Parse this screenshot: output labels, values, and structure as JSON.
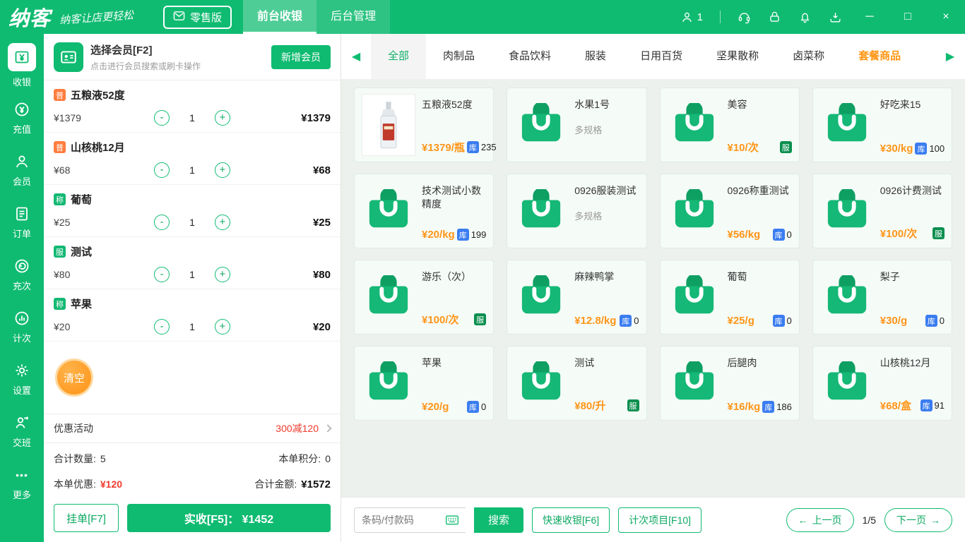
{
  "icons": {
    "minus": "-",
    "plus": "+",
    "prev": "◀",
    "next": "▶",
    "minimize": "─",
    "maximize": "□",
    "close": "×",
    "more": "•••",
    "arrow_left": "←",
    "arrow_right": "→"
  },
  "topbar": {
    "logo": "纳客",
    "slogan": "纳客让店更轻松",
    "edition": "零售版",
    "tabs": [
      {
        "label": "前台收银"
      },
      {
        "label": "后台管理"
      }
    ],
    "user_count": "1"
  },
  "sidebar": {
    "items": [
      {
        "label": "收银"
      },
      {
        "label": "充值"
      },
      {
        "label": "会员"
      },
      {
        "label": "订单"
      },
      {
        "label": "充次"
      },
      {
        "label": "计次"
      },
      {
        "label": "设置"
      },
      {
        "label": "交班"
      },
      {
        "label": "更多"
      }
    ]
  },
  "cart": {
    "member": {
      "title": "选择会员[F2]",
      "subtitle": "点击进行会员搜索或刷卡操作",
      "add_button": "新增会员"
    },
    "items": [
      {
        "tag": "普",
        "name": "五粮液52度",
        "price": "¥1379",
        "qty": "1",
        "total": "¥1379"
      },
      {
        "tag": "普",
        "name": "山核桃12月",
        "price": "¥68",
        "qty": "1",
        "total": "¥68"
      },
      {
        "tag": "称",
        "name": "葡萄",
        "price": "¥25",
        "qty": "1",
        "total": "¥25"
      },
      {
        "tag": "服",
        "name": "测试",
        "price": "¥80",
        "qty": "1",
        "total": "¥80"
      },
      {
        "tag": "称",
        "name": "苹果",
        "price": "¥20",
        "qty": "1",
        "total": "¥20"
      }
    ],
    "clear_button": "清空",
    "promo": {
      "label": "优惠活动",
      "value": "300减120"
    },
    "summary": {
      "qty_label": "合计数量:",
      "qty_value": "5",
      "points_label": "本单积分:",
      "points_value": "0",
      "discount_label": "本单优惠:",
      "discount_value": "¥120",
      "total_label": "合计金额:",
      "total_value": "¥1572"
    },
    "hold_button": "挂单[F7]",
    "pay_button": "实收[F5]： ¥1452"
  },
  "catalog": {
    "categories": [
      {
        "label": "全部"
      },
      {
        "label": "肉制品"
      },
      {
        "label": "食品饮料"
      },
      {
        "label": "服装"
      },
      {
        "label": "日用百货"
      },
      {
        "label": "坚果散称"
      },
      {
        "label": "卤菜称"
      },
      {
        "label": "套餐商品"
      }
    ],
    "products": [
      {
        "name": "五粮液52度",
        "price": "¥1379/瓶",
        "badge": "库",
        "stock": "235"
      },
      {
        "name": "水果1号",
        "spec": "多规格"
      },
      {
        "name": "美容",
        "price": "¥10/次",
        "badge": "服"
      },
      {
        "name": "好吃来15",
        "price": "¥30/kg",
        "badge": "库",
        "stock": "100"
      },
      {
        "name": "技术测试小数精度",
        "price": "¥20/kg",
        "badge": "库",
        "stock": "199"
      },
      {
        "name": "0926服装测试",
        "spec": "多规格"
      },
      {
        "name": "0926称重测试",
        "price": "¥56/kg",
        "badge": "库",
        "stock": "0"
      },
      {
        "name": "0926计费测试",
        "price": "¥100/次",
        "badge": "服"
      },
      {
        "name": "游乐（次）",
        "price": "¥100/次",
        "badge": "服"
      },
      {
        "name": "麻辣鸭掌",
        "price": "¥12.8/kg",
        "badge": "库",
        "stock": "0"
      },
      {
        "name": "葡萄",
        "price": "¥25/g",
        "badge": "库",
        "stock": "0"
      },
      {
        "name": "梨子",
        "price": "¥30/g",
        "badge": "库",
        "stock": "0"
      },
      {
        "name": "苹果",
        "price": "¥20/g",
        "badge": "库",
        "stock": "0"
      },
      {
        "name": "测试",
        "price": "¥80/升",
        "badge": "服"
      },
      {
        "name": "后腿肉",
        "price": "¥16/kg",
        "badge": "库",
        "stock": "186"
      },
      {
        "name": "山核桃12月",
        "price": "¥68/盒",
        "badge": "库",
        "stock": "91"
      }
    ],
    "footer": {
      "search_placeholder": "条码/付款码",
      "search_button": "搜索",
      "quick_button": "快速收银[F6]",
      "count_button": "计次项目[F10]",
      "prev_button": "上一页",
      "page_indicator": "1/5",
      "next_button": "下一页"
    }
  },
  "colors": {
    "brand_green": "#0fbb71",
    "price_orange": "#ff9518",
    "stock_blue": "#3a7df0",
    "service_green": "#0a8f4e",
    "danger_red": "#f03b2e"
  }
}
